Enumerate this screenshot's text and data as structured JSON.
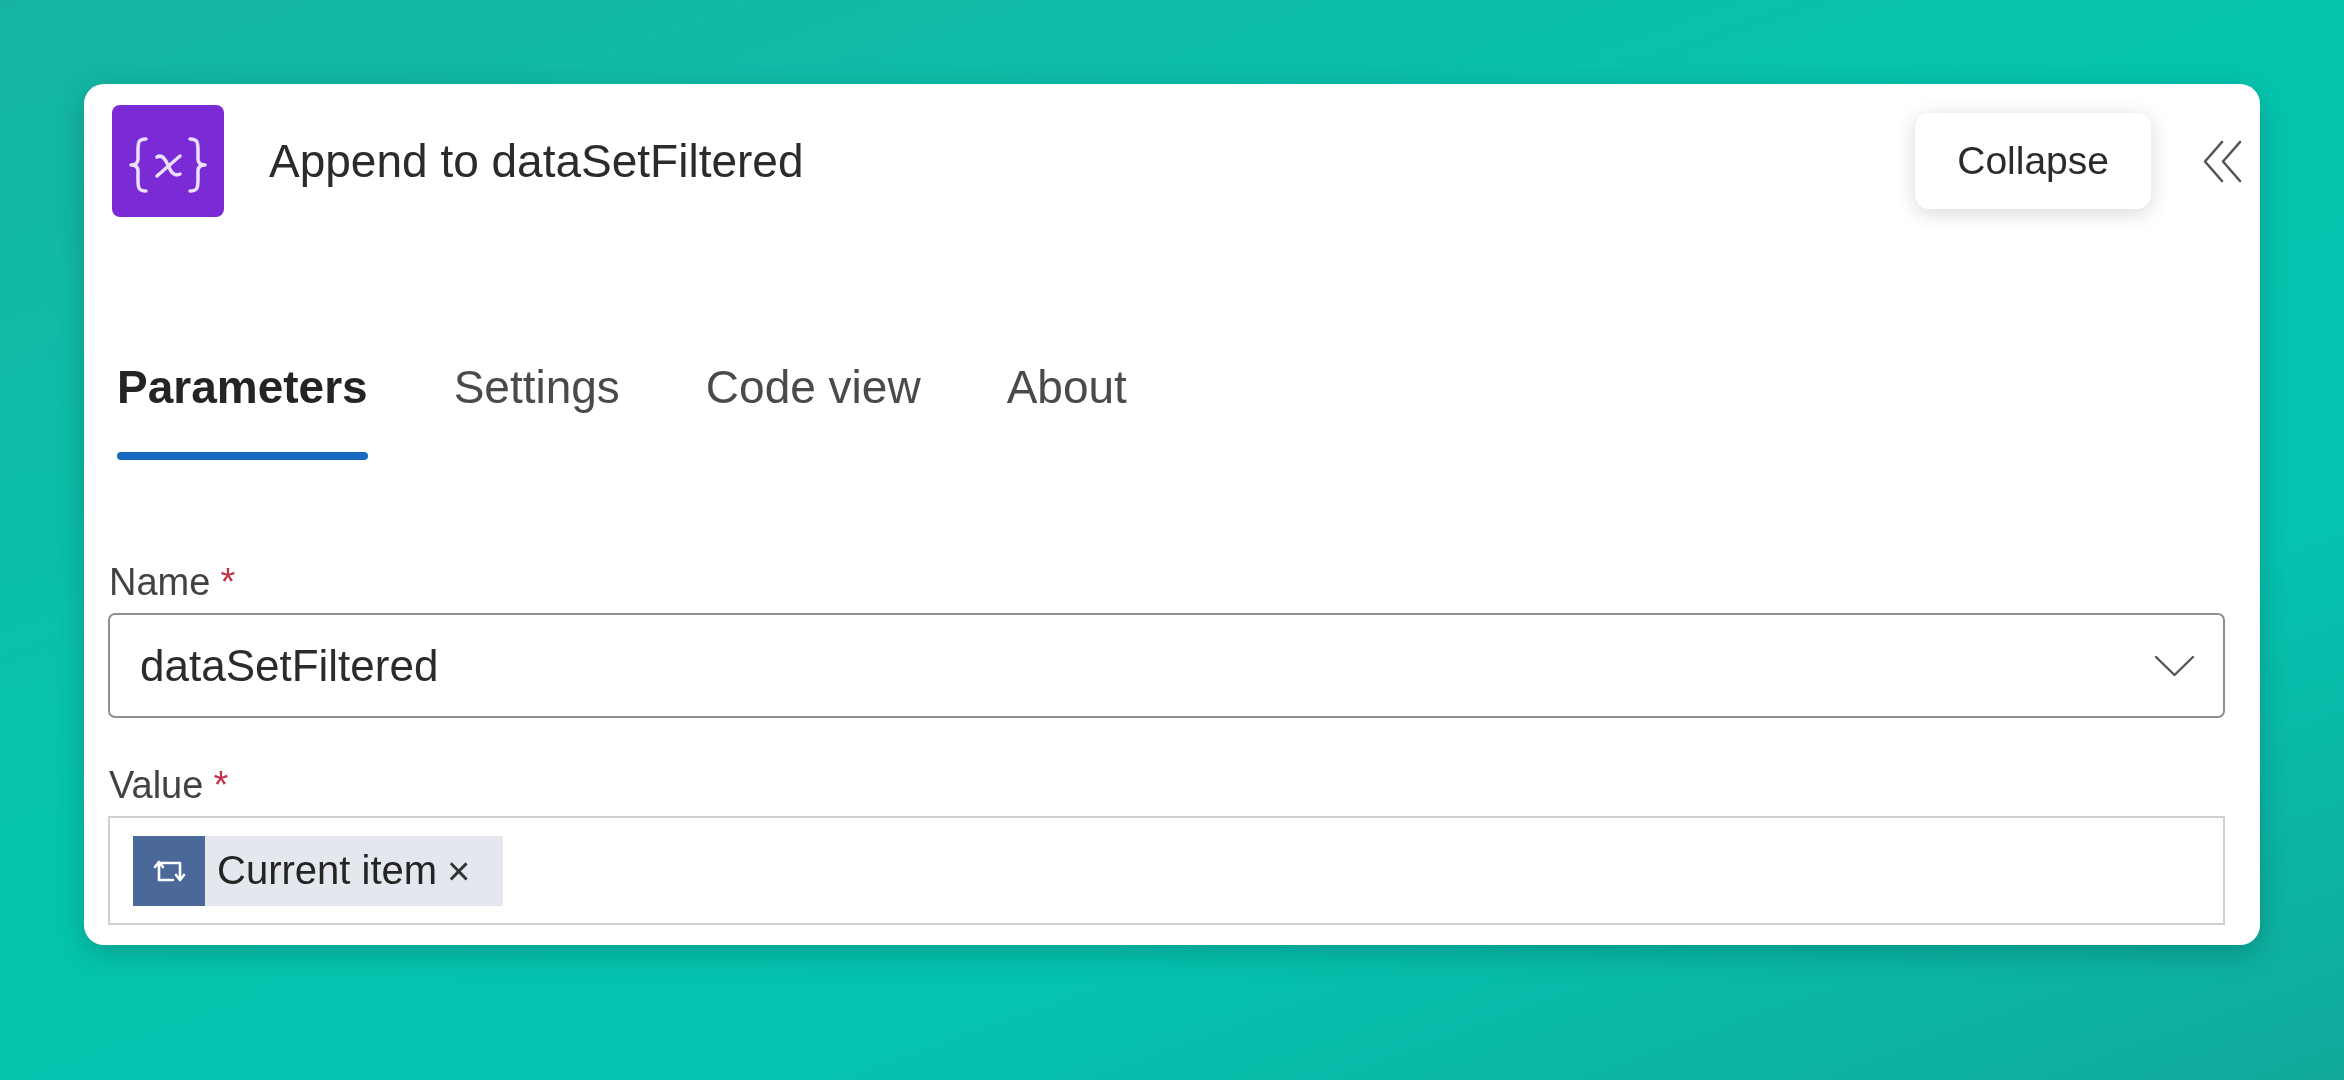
{
  "card": {
    "title": "Append to dataSetFiltered",
    "tooltip": "Collapse"
  },
  "tabs": [
    {
      "label": "Parameters",
      "selected": true
    },
    {
      "label": "Settings",
      "selected": false
    },
    {
      "label": "Code view",
      "selected": false
    },
    {
      "label": "About",
      "selected": false
    }
  ],
  "fields": [
    {
      "kind": "dropdown",
      "label": "Name",
      "required_mark": "*",
      "value": "dataSetFiltered"
    },
    {
      "kind": "tokens",
      "label": "Value",
      "required_mark": "*",
      "tokens": [
        {
          "label": "Current item",
          "remove": "×"
        }
      ]
    }
  ]
}
